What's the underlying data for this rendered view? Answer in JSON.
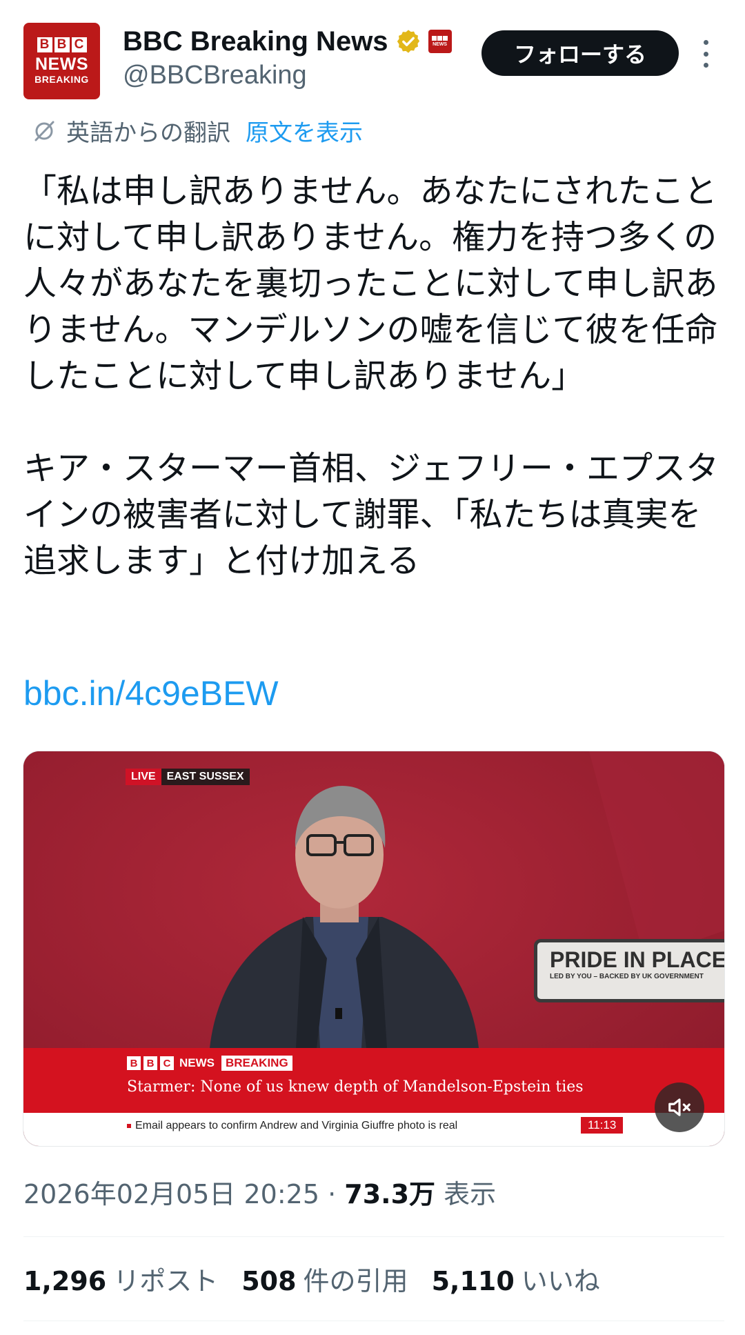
{
  "header": {
    "avatar": {
      "line1": "BBC",
      "line2": "NEWS",
      "line3": "BREAKING"
    },
    "display_name": "BBC Breaking News",
    "handle": "@BBCBreaking",
    "follow_label": "フォローする"
  },
  "translation": {
    "label": "英語からの翻訳",
    "show_original": "原文を表示"
  },
  "tweet": {
    "text": "「私は申し訳ありません。あなたにされたことに対して申し訳ありません。権力を持つ多くの人々があなたを裏切ったことに対して申し訳ありません。マンデルソンの嘘を信じて彼を任命したことに対して申し訳ありません」\n\nキア・スターマー首相、ジェフリー・エプスタインの被害者に対して謝罪、「私たちは真実を追求します」と付け加える",
    "link": "bbc.in/4c9eBEW"
  },
  "video": {
    "live_label": "LIVE",
    "location": "EAST SUSSEX",
    "sign_title": "PRIDE IN PLACE",
    "sign_sub": "LED BY YOU – BACKED BY UK GOVERNMENT",
    "brand_news": "NEWS",
    "brand_breaking": "BREAKING",
    "headline": "Starmer: None of us knew depth of Mandelson-Epstein ties",
    "ticker": "Email appears to confirm Andrew and Virginia Giuffre photo is real",
    "clock": "11:13"
  },
  "meta": {
    "datetime": "2026年02月05日 20:25",
    "separator": "·",
    "views": "73.3万",
    "views_label": "表示"
  },
  "stats": {
    "reposts": "1,296",
    "reposts_label": "リポスト",
    "quotes": "508",
    "quotes_label": "件の引用",
    "likes": "5,110",
    "likes_label": "いいね"
  },
  "colors": {
    "accent": "#1d9bf0",
    "bbc_red": "#bb1919",
    "text": "#0f1419",
    "muted": "#536471"
  }
}
